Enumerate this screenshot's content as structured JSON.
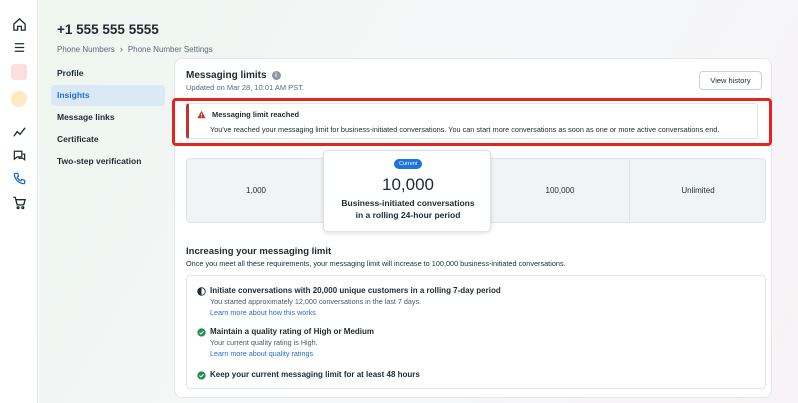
{
  "rail": {
    "icons": [
      "home-icon",
      "menu-icon",
      "app-tile-icon",
      "avatar-icon",
      "analytics-icon",
      "chat-icon",
      "phone-icon",
      "cart-icon"
    ]
  },
  "header": {
    "phone_number": "+1 555 555 5555",
    "breadcrumb": [
      "Phone Numbers",
      "Phone Number Settings"
    ]
  },
  "sidebar": {
    "items": [
      {
        "label": "Profile",
        "active": false
      },
      {
        "label": "Insights",
        "active": true
      },
      {
        "label": "Message links",
        "active": false
      },
      {
        "label": "Certificate",
        "active": false
      },
      {
        "label": "Two-step verification",
        "active": false
      }
    ]
  },
  "card": {
    "title": "Messaging limits",
    "updated": "Updated on Mar 28, 10:01 AM PST.",
    "view_history_label": "View history"
  },
  "alert": {
    "title": "Messaging limit reached",
    "text": "You've reached your messaging limit for business-initiated conversations. You can start more conversations as soon as one or more active conversations end."
  },
  "tiers": {
    "values": [
      "1,000",
      "10,000",
      "100,000",
      "Unlimited"
    ],
    "current": {
      "badge": "Current",
      "value": "10,000",
      "label_line1": "Business-initiated conversations",
      "label_line2": "in a rolling 24-hour period"
    }
  },
  "increasing": {
    "title": "Increasing your messaging limit",
    "subtitle": "Once you meet all these requirements, your messaging limit will increase to 100,000 business-initiated conversations.",
    "requirements": [
      {
        "status": "in-progress",
        "title": "Initiate conversations with 20,000 unique customers in a rolling 7-day period",
        "desc": "You started approximately 12,000 conversations in the last 7 days.",
        "link": "Learn more about how this works"
      },
      {
        "status": "complete",
        "title": "Maintain a quality rating of High or Medium",
        "desc": "Your current quality rating is High.",
        "link": "Learn more about quality ratings"
      },
      {
        "status": "complete",
        "title": "Keep your current messaging limit for at least 48 hours",
        "desc": "",
        "link": ""
      }
    ]
  },
  "colors": {
    "accent": "#1d6fd1",
    "alert_red": "#c3322b",
    "highlight_outline": "#e8231d",
    "success": "#1e8f4e",
    "badge": "#1d73e0"
  }
}
